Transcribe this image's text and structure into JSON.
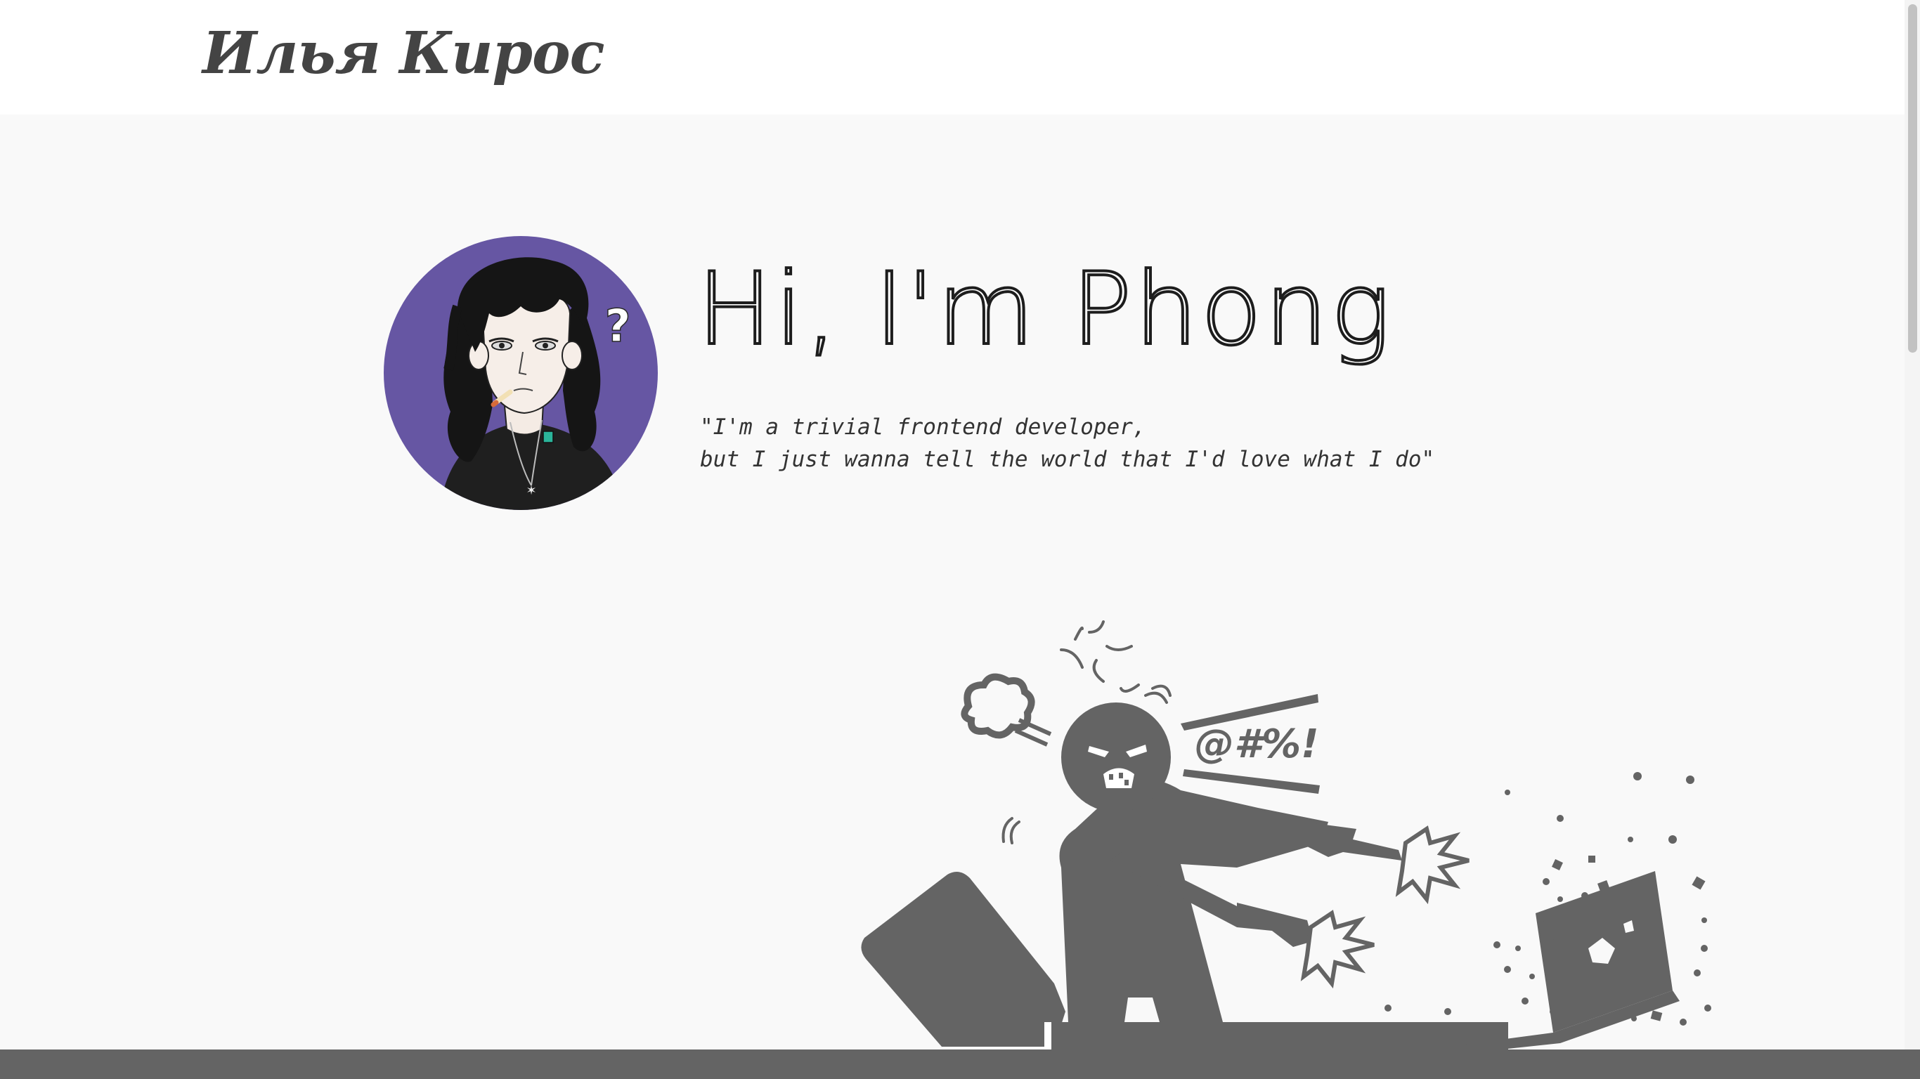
{
  "header": {
    "logo": "Илья Кирос"
  },
  "hero": {
    "greeting": "Hi, I'm Phong",
    "quote_line1": "\"I'm a trivial frontend developer,",
    "quote_line2": "but I just wanna tell the world that I'd love what I do\"",
    "avatar_question_mark": "?"
  },
  "illustration": {
    "swear_text": "@#%!"
  },
  "colors": {
    "avatar_bg": "#6656a3",
    "illustration": "#646464",
    "page_bg": "#f9f9f9",
    "header_bg": "#ffffff"
  }
}
